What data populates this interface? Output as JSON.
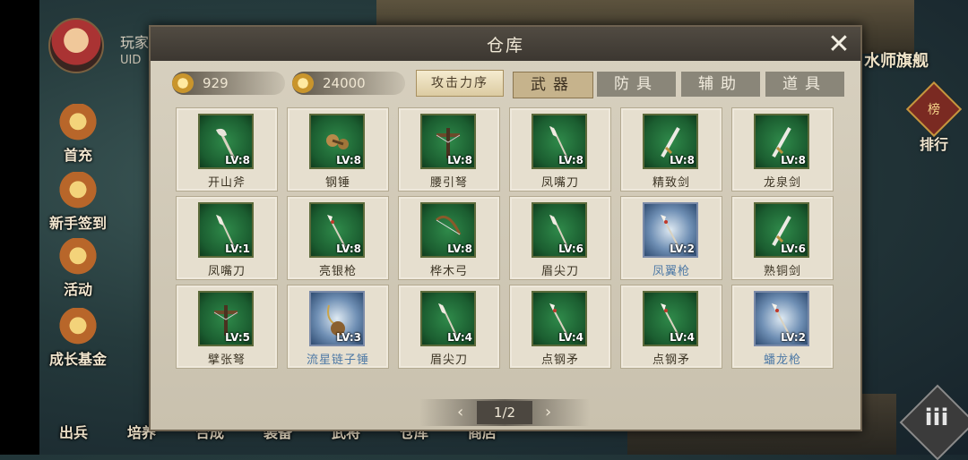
{
  "player": {
    "name": "玩家",
    "uid_label": "UID"
  },
  "side_menu": [
    {
      "label": "首充"
    },
    {
      "label": "新手签到"
    },
    {
      "label": "活动"
    },
    {
      "label": "成长基金"
    }
  ],
  "bottom_menu": [
    "出兵",
    "培养",
    "合成",
    "装备",
    "武将",
    "仓库",
    "商店"
  ],
  "right": {
    "ship_title": "水师旗舰",
    "rank_badge": "榜",
    "rank_label": "排行",
    "menu_glyph": "iii"
  },
  "modal": {
    "title": "仓库",
    "resources": {
      "silver": "929",
      "copper": "24000"
    },
    "sort_label": "攻击力序",
    "tabs": [
      "武器",
      "防具",
      "辅助",
      "道具"
    ],
    "active_tab": 0,
    "items": [
      {
        "name": "开山斧",
        "lv": "LV:8",
        "rarity": "green",
        "icon": "axe-icon"
      },
      {
        "name": "钢锤",
        "lv": "LV:8",
        "rarity": "green",
        "icon": "hammer-icon"
      },
      {
        "name": "腰引弩",
        "lv": "LV:8",
        "rarity": "green",
        "icon": "crossbow-icon"
      },
      {
        "name": "凤嘴刀",
        "lv": "LV:8",
        "rarity": "green",
        "icon": "glaive-icon"
      },
      {
        "name": "精致剑",
        "lv": "LV:8",
        "rarity": "green",
        "icon": "sword-icon"
      },
      {
        "name": "龙泉剑",
        "lv": "LV:8",
        "rarity": "green",
        "icon": "sword-icon"
      },
      {
        "name": "凤嘴刀",
        "lv": "LV:1",
        "rarity": "green",
        "icon": "glaive-icon"
      },
      {
        "name": "亮银枪",
        "lv": "LV:8",
        "rarity": "green",
        "icon": "spear-icon"
      },
      {
        "name": "桦木弓",
        "lv": "LV:8",
        "rarity": "green",
        "icon": "bow-icon"
      },
      {
        "name": "眉尖刀",
        "lv": "LV:6",
        "rarity": "green",
        "icon": "glaive-icon"
      },
      {
        "name": "凤翼枪",
        "lv": "LV:2",
        "rarity": "blue",
        "icon": "spear-icon"
      },
      {
        "name": "熟铜剑",
        "lv": "LV:6",
        "rarity": "green",
        "icon": "sword-icon"
      },
      {
        "name": "擘张弩",
        "lv": "LV:5",
        "rarity": "green",
        "icon": "crossbow-icon"
      },
      {
        "name": "流星链子锤",
        "lv": "LV:3",
        "rarity": "blue",
        "icon": "flail-icon"
      },
      {
        "name": "眉尖刀",
        "lv": "LV:4",
        "rarity": "green",
        "icon": "glaive-icon"
      },
      {
        "name": "点钢矛",
        "lv": "LV:4",
        "rarity": "green",
        "icon": "spear-icon"
      },
      {
        "name": "点钢矛",
        "lv": "LV:4",
        "rarity": "green",
        "icon": "spear-icon"
      },
      {
        "name": "蟠龙枪",
        "lv": "LV:2",
        "rarity": "blue",
        "icon": "spear-icon"
      }
    ],
    "pager": {
      "prev": "‹",
      "page": "1/2",
      "next": "›"
    }
  }
}
